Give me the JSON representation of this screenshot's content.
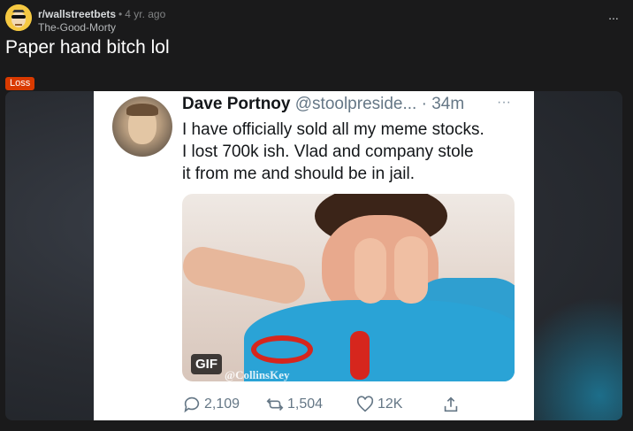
{
  "post": {
    "subreddit": "r/wallstreetbets",
    "separator": "•",
    "age": "4 yr. ago",
    "author": "The-Good-Morty",
    "more": "...",
    "title": "Paper hand bitch lol",
    "flair": "Loss",
    "flair_color": "#d93a00"
  },
  "tweet": {
    "name": "Dave Portnoy",
    "handle": "@stoolpreside...",
    "time": "· 34m",
    "more": "···",
    "lines": [
      "I have officially sold all my meme stocks.",
      "I lost 700k ish.   Vlad and company stole",
      "it from me and should be in jail."
    ],
    "gif_badge": "GIF",
    "watermark": "@CollinsKey",
    "replies": "2,109",
    "retweets": "1,504",
    "likes": "12K"
  },
  "icons": [
    "snoo-avatar-icon",
    "reply-icon",
    "retweet-icon",
    "like-icon",
    "share-icon"
  ]
}
